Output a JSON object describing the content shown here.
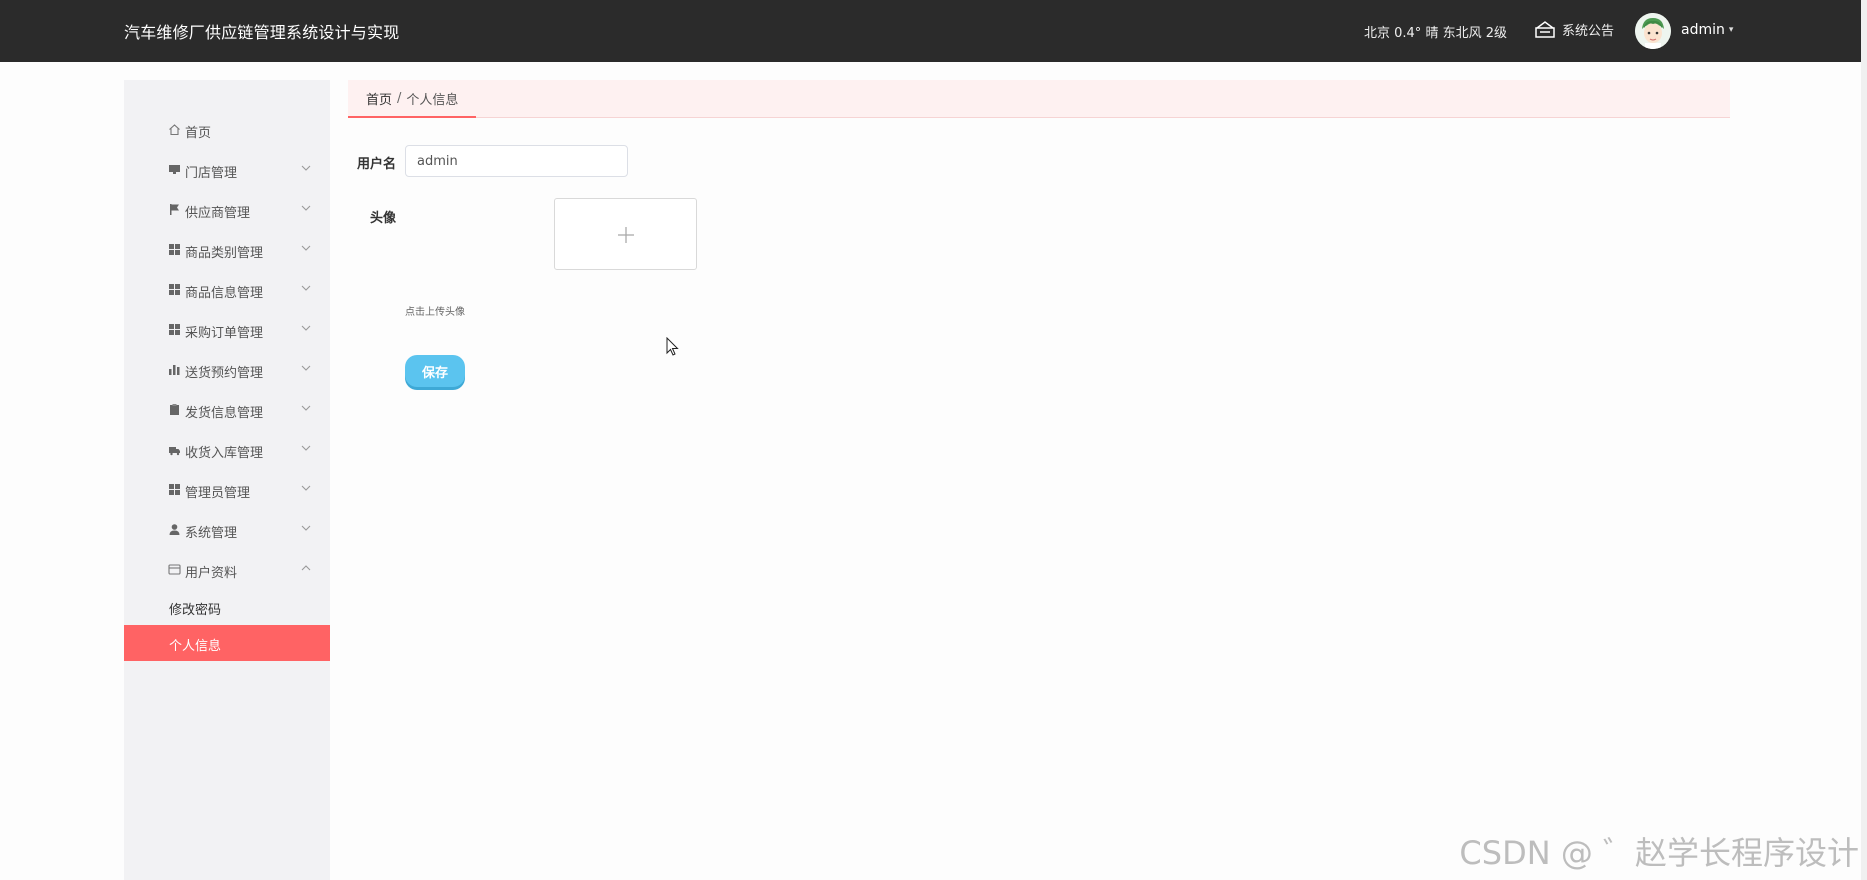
{
  "header": {
    "app_title": "汽车维修厂供应链管理系统设计与实现",
    "weather": "北京  0.4°  晴  东北风  2级",
    "notice_label": "系统公告",
    "username": "admin",
    "username_caret": "▾"
  },
  "sidebar": {
    "items": [
      {
        "label": "首页",
        "icon": "home-icon"
      },
      {
        "label": "门店管理",
        "icon": "monitor-icon"
      },
      {
        "label": "供应商管理",
        "icon": "flag-icon"
      },
      {
        "label": "商品类别管理",
        "icon": "grid-icon"
      },
      {
        "label": "商品信息管理",
        "icon": "grid-icon"
      },
      {
        "label": "采购订单管理",
        "icon": "grid-icon"
      },
      {
        "label": "送货预约管理",
        "icon": "bar-chart-icon"
      },
      {
        "label": "发货信息管理",
        "icon": "clipboard-icon"
      },
      {
        "label": "收货入库管理",
        "icon": "truck-icon"
      },
      {
        "label": "管理员管理",
        "icon": "grid-icon"
      },
      {
        "label": "系统管理",
        "icon": "user-icon"
      },
      {
        "label": "用户资料",
        "icon": "card-icon"
      }
    ],
    "sub_items": [
      {
        "label": "修改密码",
        "active": false
      },
      {
        "label": "个人信息",
        "active": true
      }
    ]
  },
  "breadcrumb": {
    "home": "首页",
    "separator": "/",
    "current": "个人信息"
  },
  "form": {
    "username_label": "用户名",
    "username_value": "admin",
    "avatar_label": "头像",
    "upload_tip": "点击上传头像",
    "save_label": "保存"
  },
  "watermark": "CSDN @ ゛赵学长程序设计",
  "colors": {
    "topbar_bg": "#2b2b2b",
    "accent": "#ff6364",
    "button": "#5bc4ef",
    "sidebar_bg": "#f2f2f4"
  }
}
